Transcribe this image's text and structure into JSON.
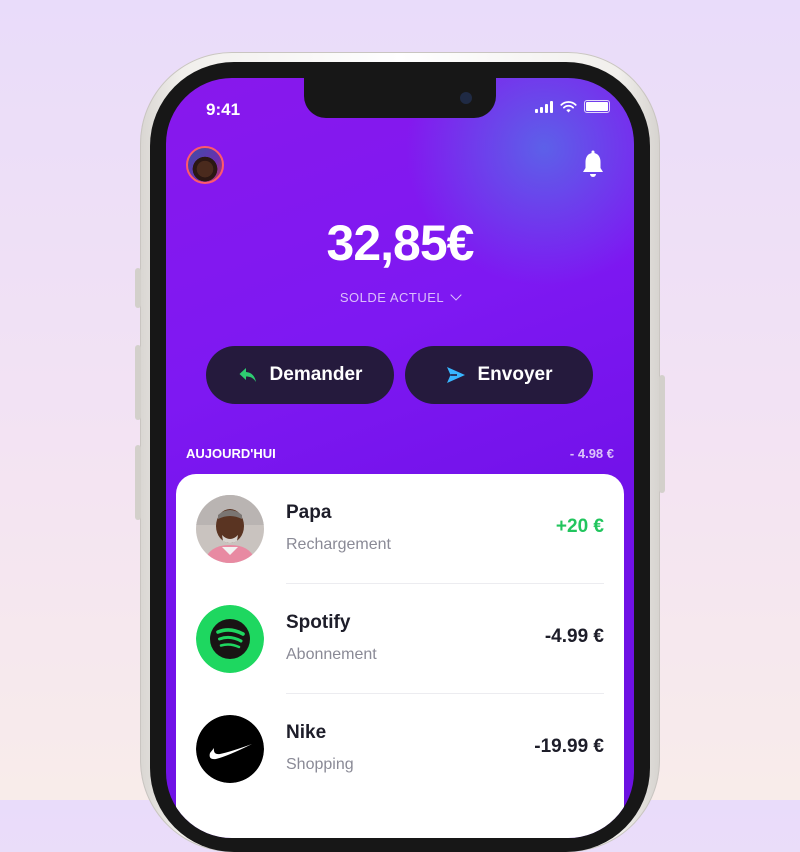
{
  "status_bar": {
    "time": "9:41"
  },
  "balance": {
    "amount": "32,85€",
    "label": "SOLDE ACTUEL"
  },
  "actions": {
    "request_label": "Demander",
    "send_label": "Envoyer"
  },
  "section": {
    "title": "AUJOURD'HUI",
    "total": "- 4.98 €"
  },
  "transactions": [
    {
      "name": "Papa",
      "category": "Rechargement",
      "amount": "+20 €",
      "positive": true,
      "icon": "person-photo"
    },
    {
      "name": "Spotify",
      "category": "Abonnement",
      "amount": "-4.99 €",
      "positive": false,
      "icon": "spotify-logo"
    },
    {
      "name": "Nike",
      "category": "Shopping",
      "amount": "-19.99 €",
      "positive": false,
      "icon": "nike-logo"
    }
  ],
  "colors": {
    "accent": "#7a16ee",
    "positive": "#22c55e",
    "button_dark": "#251a3d",
    "spotify": "#1ed760"
  }
}
